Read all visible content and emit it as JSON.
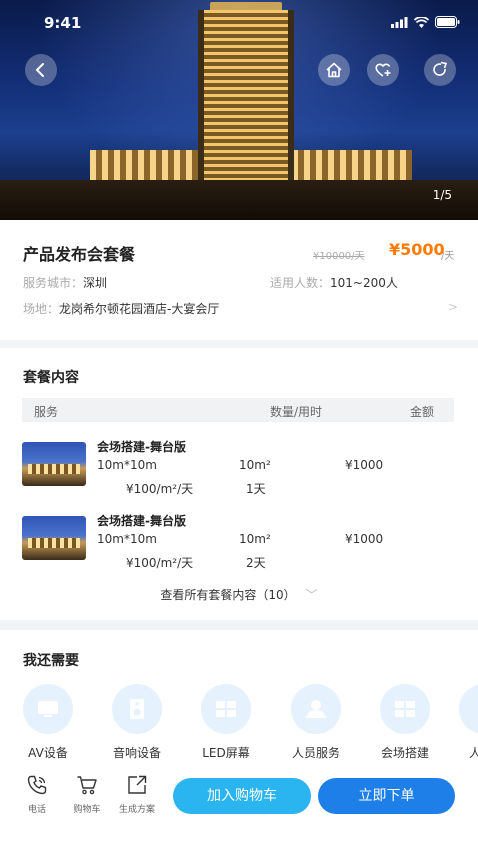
{
  "status_bar": {
    "time": "9:41"
  },
  "hero": {
    "pager": "1/5"
  },
  "product": {
    "title": "产品发布会套餐",
    "old_price": "¥10000/天",
    "price": "¥5000",
    "price_unit": "/天",
    "city_label": "服务城市：",
    "city": "深圳",
    "capacity_label": "适用人数：",
    "capacity": "101~200人",
    "venue_label": "场地：",
    "venue": "龙岗希尔顿花园酒店-大宴会厅"
  },
  "package": {
    "title": "套餐内容",
    "headers": {
      "service": "服务",
      "qty": "数量/用时",
      "amount": "金额"
    },
    "rows": [
      {
        "name": "会场搭建-舞台版",
        "size": "10m*10m",
        "unit_price": "¥100/m²/天",
        "qty": "10m²",
        "days": "1天",
        "amount": "¥1000"
      },
      {
        "name": "会场搭建-舞台版",
        "size": "10m*10m",
        "unit_price": "¥100/m²/天",
        "qty": "10m²",
        "days": "2天",
        "amount": "¥1000"
      }
    ],
    "see_all": "查看所有套餐内容（10）"
  },
  "needs": {
    "title": "我还需要",
    "items": [
      {
        "label": "AV设备",
        "icon": "monitor-icon"
      },
      {
        "label": "音响设备",
        "icon": "speaker-icon"
      },
      {
        "label": "LED屏幕",
        "icon": "led-screen-icon"
      },
      {
        "label": "人员服务",
        "icon": "staff-icon"
      },
      {
        "label": "会场搭建",
        "icon": "venue-build-icon"
      },
      {
        "label": "人",
        "icon": "person-icon"
      }
    ]
  },
  "bottom_bar": {
    "phone": "电话",
    "cart": "购物车",
    "plan": "生成方案",
    "add_to_cart": "加入购物车",
    "order_now": "立即下单"
  },
  "colors": {
    "accent_price": "#ff7a00",
    "cart_button": "#2ab4f0",
    "order_button": "#1e7fe8",
    "icon_bg": "#e5f1fc"
  }
}
